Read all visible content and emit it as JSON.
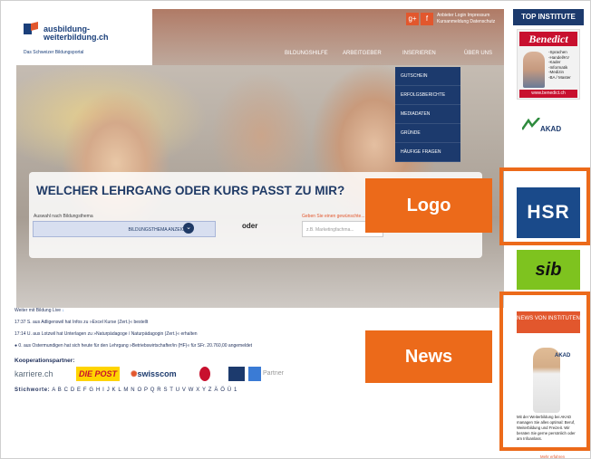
{
  "header": {
    "logo_line1": "ausbildung-",
    "logo_line2": "weiterbildung.ch",
    "logo_sub": "Das Schweizer Bildungsportal",
    "social_gplus": "g+",
    "social_fb": "f",
    "toplinks": "Anbieter Login   Impressum\nKursanmeldung   Datenschutz"
  },
  "nav": {
    "items": [
      "BILDUNGSHILFE",
      "ARBEITGEBER",
      "INSERIEREN",
      "ÜBER UNS"
    ],
    "dropdown": [
      "GUTSCHEIN",
      "ERFOLGSBERICHTE",
      "MEDIADATEN",
      "GRÜNDE",
      "HÄUFIGE FRAGEN"
    ]
  },
  "question": {
    "title": "WELCHER LEHRGANG ODER KURS PASST ZU MIR?",
    "label_left": "Auswahl nach Bildungsthema",
    "select_value": "BILDUNGSTHEMA ANZEIGEN",
    "oder": "oder",
    "label_right": "Geben Sie einen gewünschte...",
    "input_placeholder": "z.B. Marketingfachma..."
  },
  "live": {
    "heading": "Weiter mit Bildung Live",
    "entries": [
      "17:37  S. aus Adligenswil hat Infos zu »Excel Kurse (Zert.)« bestellt",
      "17:14  U. aus Lotzwil hat Unterlagen zu »Naturpädagoge / Naturpädagogin (Zert.)« erhalten",
      "0. aus Ostermundigen hat sich heute für den Lehrgang »Betriebswirtschafter/in (HF)« für SFr. 20.760,00 angemeldet"
    ],
    "partners_label": "Kooperationspartner:",
    "partners": [
      "karriere.ch",
      "DIE POST",
      "swisscom",
      "",
      "",
      "Partner"
    ],
    "stichworte_label": "Stichworte:",
    "letters": "A B C D E F G H I J K L M N O P Q R S T U V W X Y Z Ä Ö Ü 1"
  },
  "sidebar": {
    "top_institute": "TOP INSTITUTE",
    "benedict": "Benedict",
    "benedict_list": "-Sprachen\n-Handel/KV\n-Kader\n-Informatik\n-Medizin\n-BA / Master",
    "benedict_url": "www.benedict.ch",
    "akad": "AKAD",
    "hsr": "HSR",
    "sib": "sib",
    "news_head": "NEWS VON INSTITUTEN",
    "news_akad": "AKAD",
    "news_text": "Mit der Weiterbildung bei AKAD managen Sie alles optimal: Beruf, Weiterbildung und Freizeit. Wir beraten Sie gerne persönlich oder am Infoanlass.",
    "news_more": "Mehr erfahren"
  },
  "overlays": {
    "logo_label": "Logo",
    "news_label": "News"
  }
}
